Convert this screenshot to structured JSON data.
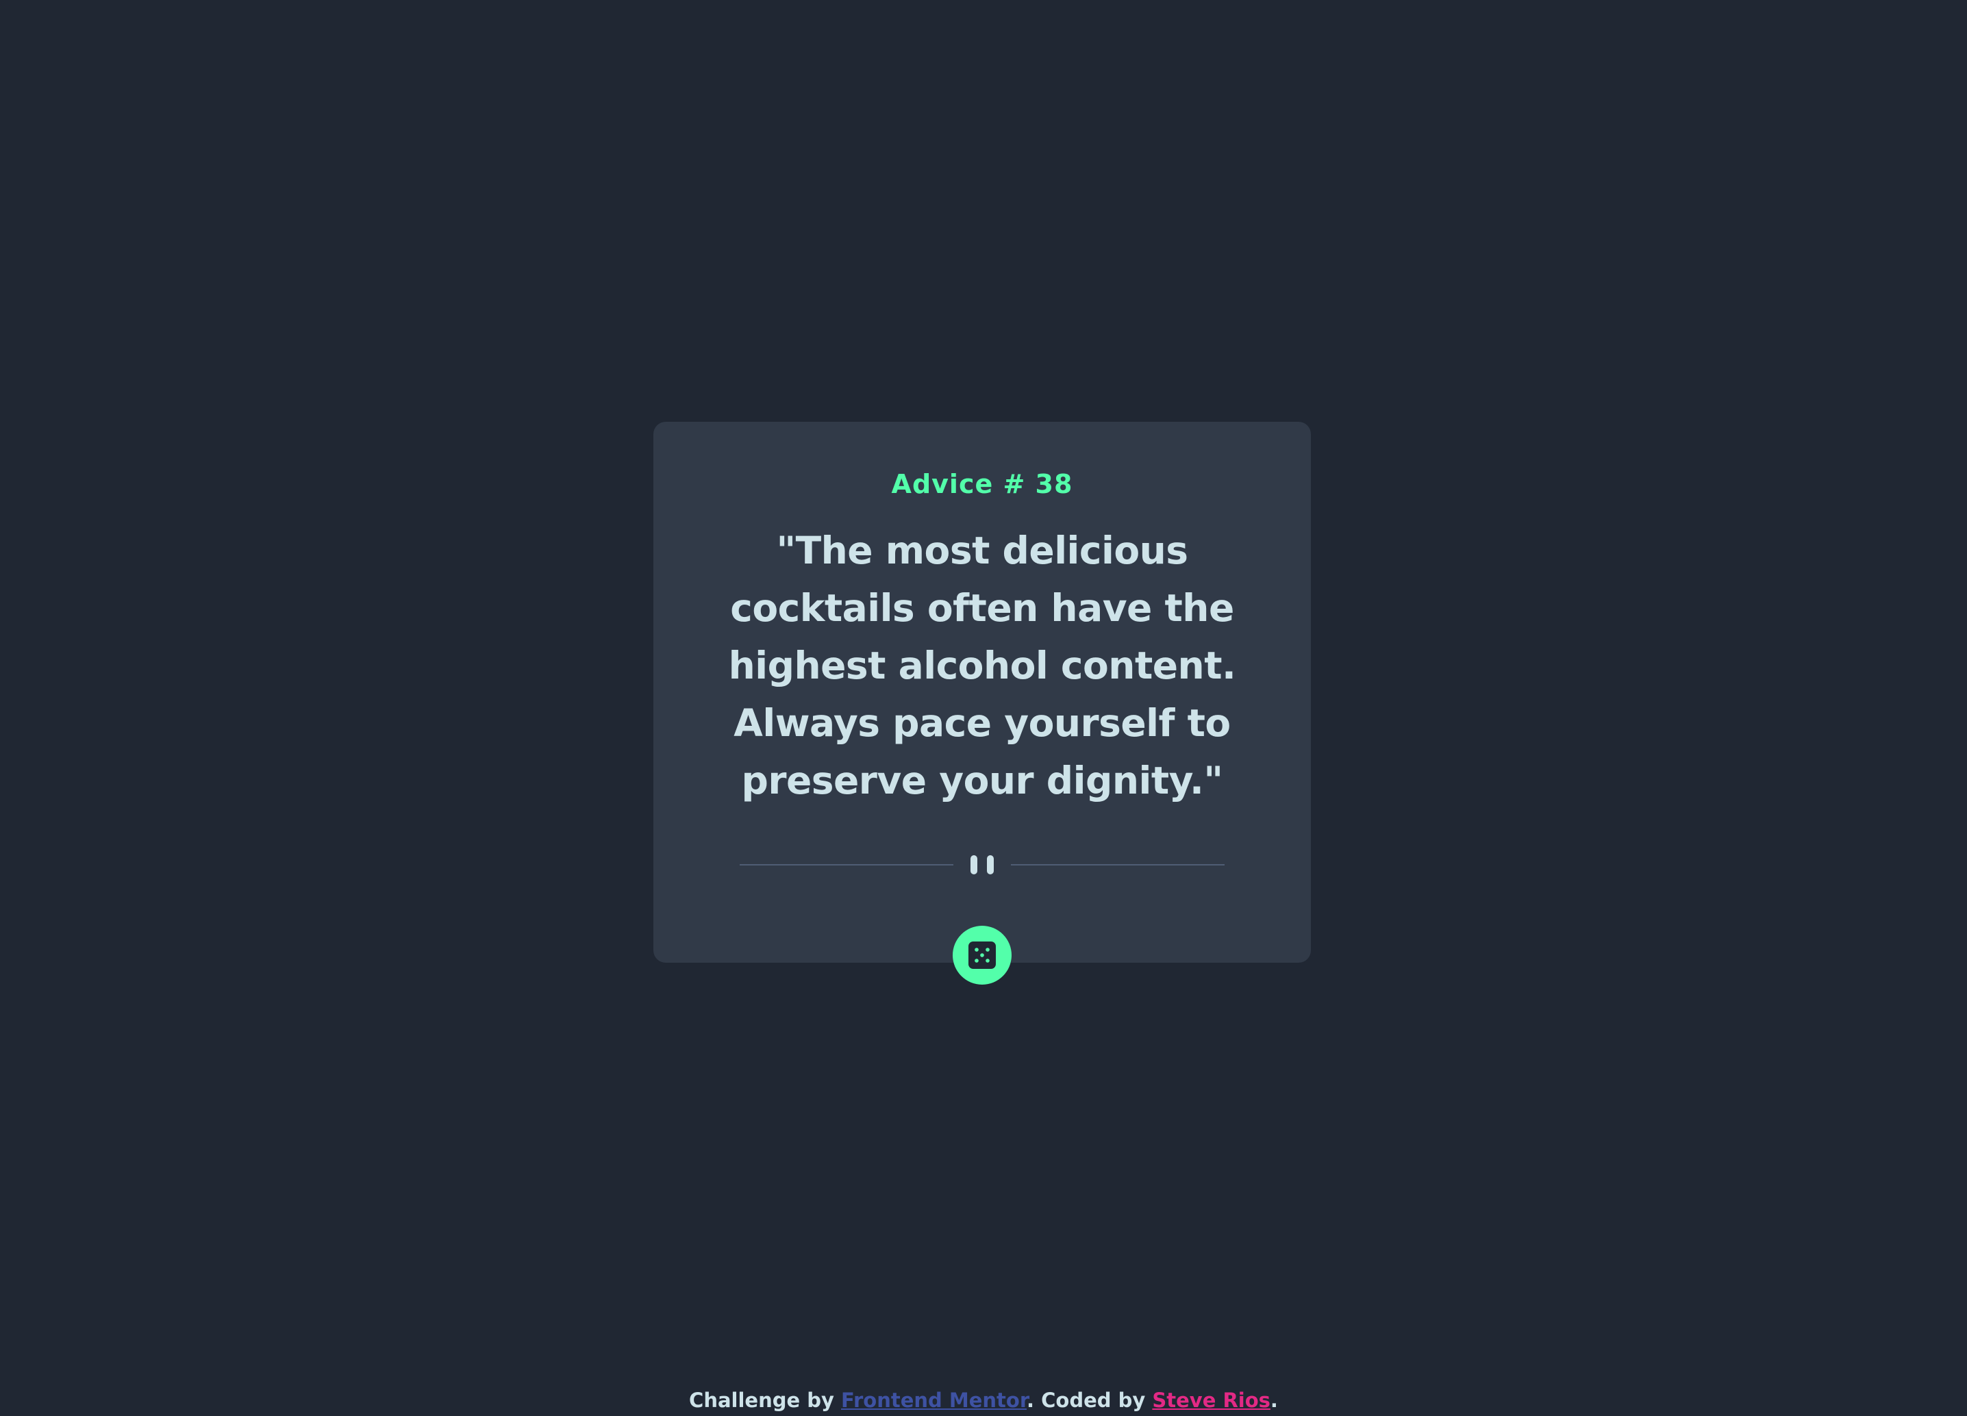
{
  "card": {
    "advice_label": "Advice # 38",
    "advice_text": "\"The most delicious cocktails often have the highest alcohol content. Always pace yourself to preserve your dignity.\""
  },
  "divider": {
    "icon": "pause-quote-icon"
  },
  "dice_button": {
    "icon": "dice-icon"
  },
  "footer": {
    "prefix": "Challenge by ",
    "challenge_link": "Frontend Mentor",
    "middle": ". Coded by ",
    "author_link": "Steve Rios",
    "suffix": "."
  },
  "colors": {
    "background": "#202733",
    "card": "#313a48",
    "accent_green": "#53ffaa",
    "text_light": "#cee3e9",
    "divider": "#4f5d74",
    "link_blue": "#3e52a3",
    "link_pink": "#e32985"
  }
}
